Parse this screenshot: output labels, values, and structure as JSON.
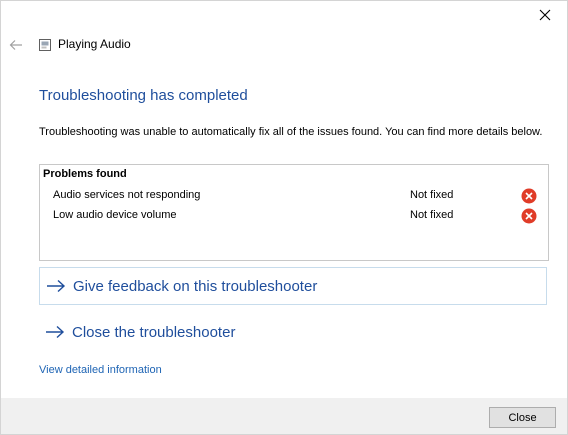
{
  "window": {
    "app_title": "Playing Audio"
  },
  "main": {
    "heading": "Troubleshooting has completed",
    "description": "Troubleshooting was unable to automatically fix all of the issues found. You can find more details below."
  },
  "problems": {
    "title": "Problems found",
    "items": [
      {
        "name": "Audio services not responding",
        "status": "Not fixed",
        "status_icon": "error-circle-icon"
      },
      {
        "name": "Low audio device volume",
        "status": "Not fixed",
        "status_icon": "error-circle-icon"
      }
    ]
  },
  "links": {
    "feedback": "Give feedback on this troubleshooter",
    "close_troubleshooter": "Close the troubleshooter",
    "detailed_info": "View detailed information"
  },
  "footer": {
    "close_label": "Close"
  },
  "colors": {
    "heading": "#1f4e9c",
    "link": "#1e64b4",
    "error": "#e03c28",
    "footer_bg": "#f0f0f0"
  }
}
